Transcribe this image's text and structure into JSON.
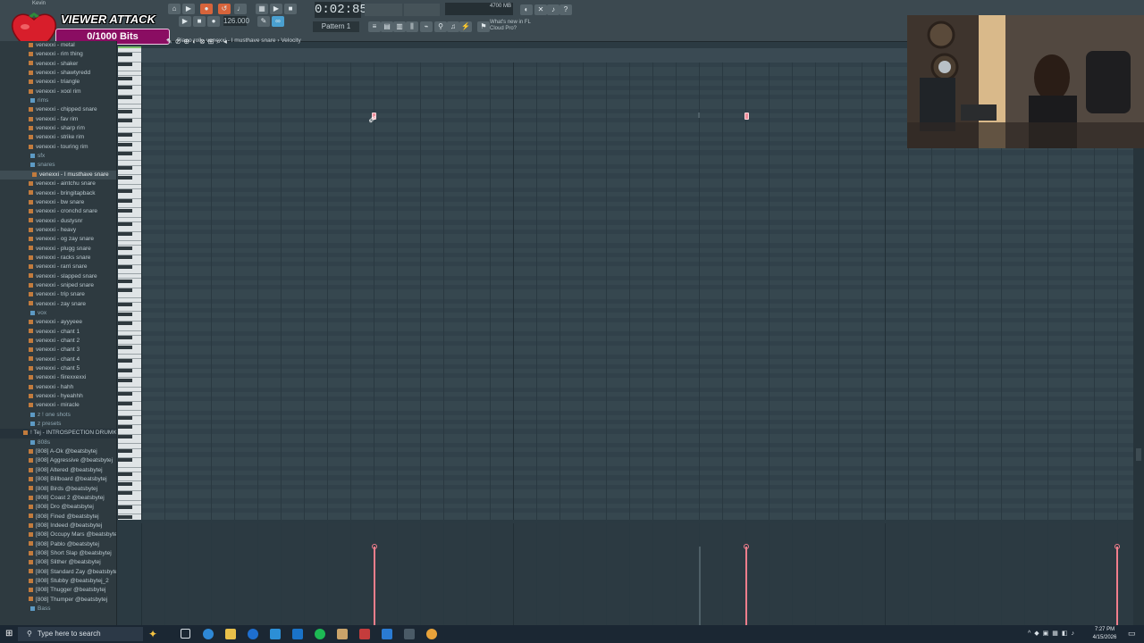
{
  "overlay": {
    "title": "VIEWER ATTACK",
    "bits": "0/1000 Bits"
  },
  "toolbar": {
    "time": "0:02:85",
    "tempo": "126.000",
    "pattern": "Pattern 1",
    "memory": "4700 MB",
    "news_line1": "What's new in FL",
    "news_line2": "Cloud Pro?",
    "user": "Kevin"
  },
  "piano_roll": {
    "header": "Piano roll - venexxi - I musthave snare › Velocity"
  },
  "browser": {
    "items": [
      {
        "label": "venexxi - metal",
        "type": "file"
      },
      {
        "label": "venexxi - rim thing",
        "type": "file"
      },
      {
        "label": "venexxi - shaker",
        "type": "file"
      },
      {
        "label": "venexxi - shawtyredd",
        "type": "file"
      },
      {
        "label": "venexxi - triangle",
        "type": "file"
      },
      {
        "label": "venexxi - xool rim",
        "type": "file"
      },
      {
        "label": "rims",
        "type": "folder"
      },
      {
        "label": "venexxi - chipped snare",
        "type": "file"
      },
      {
        "label": "venexxi - fav rim",
        "type": "file"
      },
      {
        "label": "venexxi - sharp rim",
        "type": "file"
      },
      {
        "label": "venexxi - strike rim",
        "type": "file"
      },
      {
        "label": "venexxi - touring rim",
        "type": "file"
      },
      {
        "label": "sfx",
        "type": "folder"
      },
      {
        "label": "snares",
        "type": "folder"
      },
      {
        "label": "venexxi - I musthave snare",
        "type": "selected"
      },
      {
        "label": "venexxi - aintchu snare",
        "type": "file"
      },
      {
        "label": "venexxi - bringitapback",
        "type": "file"
      },
      {
        "label": "venexxi - bw snare",
        "type": "file"
      },
      {
        "label": "venexxi - cronchd snare",
        "type": "file"
      },
      {
        "label": "venexxi - dustysnr",
        "type": "file"
      },
      {
        "label": "venexxi - heavy",
        "type": "file"
      },
      {
        "label": "venexxi - og zay snare",
        "type": "file"
      },
      {
        "label": "venexxi - plugg snare",
        "type": "file"
      },
      {
        "label": "venexxi - racks snare",
        "type": "file"
      },
      {
        "label": "venexxi - rarri snare",
        "type": "file"
      },
      {
        "label": "venexxi - slapped snare",
        "type": "file"
      },
      {
        "label": "venexxi - sniped snare",
        "type": "file"
      },
      {
        "label": "venexxi - trip snare",
        "type": "file"
      },
      {
        "label": "venexxi - zay snare",
        "type": "file"
      },
      {
        "label": "vox",
        "type": "folder"
      },
      {
        "label": "venexxi - ayyyeee",
        "type": "file"
      },
      {
        "label": "venexxi - chant 1",
        "type": "file"
      },
      {
        "label": "venexxi - chant 2",
        "type": "file"
      },
      {
        "label": "venexxi - chant 3",
        "type": "file"
      },
      {
        "label": "venexxi - chant 4",
        "type": "file"
      },
      {
        "label": "venexxi - chant 5",
        "type": "file"
      },
      {
        "label": "venexxi - fiirexxexxi",
        "type": "file"
      },
      {
        "label": "venexxi - hahh",
        "type": "file"
      },
      {
        "label": "venexxi - hyeahhh",
        "type": "file"
      },
      {
        "label": "venexxi - miracle",
        "type": "file"
      },
      {
        "label": "z ! one shots",
        "type": "folder"
      },
      {
        "label": "z presets",
        "type": "folder"
      },
      {
        "label": "! Tej - INTROSPECTION DRUMKIT",
        "type": "section"
      },
      {
        "label": "808s",
        "type": "folder"
      },
      {
        "label": "[808] A-Ok @beatsbytej",
        "type": "file"
      },
      {
        "label": "[808] Aggressive @beatsbytej",
        "type": "file"
      },
      {
        "label": "[808] Altered @beatsbytej",
        "type": "file"
      },
      {
        "label": "[808] Billboard @beatsbytej",
        "type": "file"
      },
      {
        "label": "[808] Birds @beatsbytej",
        "type": "file"
      },
      {
        "label": "[808] Coast 2 @beatsbytej",
        "type": "file"
      },
      {
        "label": "[808] Dro @beatsbytej",
        "type": "file"
      },
      {
        "label": "[808] Fined @beatsbytej",
        "type": "file"
      },
      {
        "label": "[808] Indeed @beatsbytej",
        "type": "file"
      },
      {
        "label": "[808] Occupy Mars @beatsbytej",
        "type": "file"
      },
      {
        "label": "[808] Pablo @beatsbytej",
        "type": "file"
      },
      {
        "label": "[808] Short Slap @beatsbytej",
        "type": "file"
      },
      {
        "label": "[808] Slither @beatsbytej",
        "type": "file"
      },
      {
        "label": "[808] Standard Zay @beatsbytej",
        "type": "file"
      },
      {
        "label": "[808] Stubby @beatsbytej_2",
        "type": "file"
      },
      {
        "label": "[808] Thugger @beatsbytej",
        "type": "file"
      },
      {
        "label": "[808] Thumper @beatsbytej",
        "type": "file"
      },
      {
        "label": "Bass",
        "type": "folder"
      }
    ]
  },
  "taskbar": {
    "search_placeholder": "Type here to search",
    "time": "7:27 PM",
    "date": "4/15/2026"
  },
  "colors": {
    "accent": "#d7643b",
    "note": "#f08e9b",
    "overlay_bar": "#8a0d62"
  }
}
